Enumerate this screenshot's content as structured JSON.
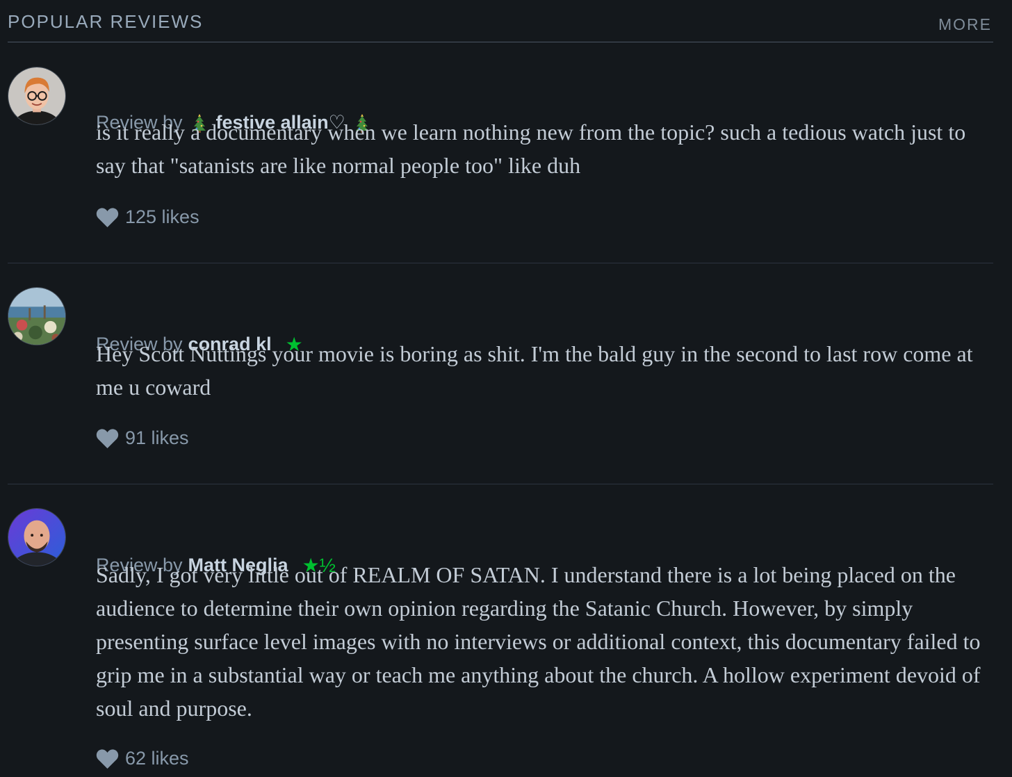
{
  "section": {
    "title": "POPULAR REVIEWS",
    "more_label": "MORE"
  },
  "reviews": [
    {
      "byline_prefix": "Review by",
      "username": "festive allain♡",
      "name_decoration_icon": "christmas-tree-icon",
      "rating": "",
      "text": "is it really a documentary when we learn nothing new from the topic? such a tedious watch just to say that \"satanists are like normal people too\" like duh",
      "likes": "125 likes"
    },
    {
      "byline_prefix": "Review by",
      "username": "conrad kl",
      "rating": "★",
      "text": "Hey Scott Nuttings your movie is boring as shit. I'm the bald guy in the second to last row come at me u coward",
      "likes": "91 likes"
    },
    {
      "byline_prefix": "Review by",
      "username": "Matt Neglia",
      "rating": "★½",
      "text": "Sadly, I got very little out of REALM OF SATAN. I understand there is a lot being placed on the audience to determine their own opinion regarding the Satanic Church. However, by simply presenting surface level images with no interviews or additional context, this documentary failed to grip me in a substantial way or teach me anything about the church. A hollow experiment devoid of soul and purpose.",
      "likes": "62 likes"
    }
  ],
  "colors": {
    "background": "#14181c",
    "rating_green": "#00c030",
    "username": "#c8d4e0",
    "muted": "#8899aa"
  }
}
